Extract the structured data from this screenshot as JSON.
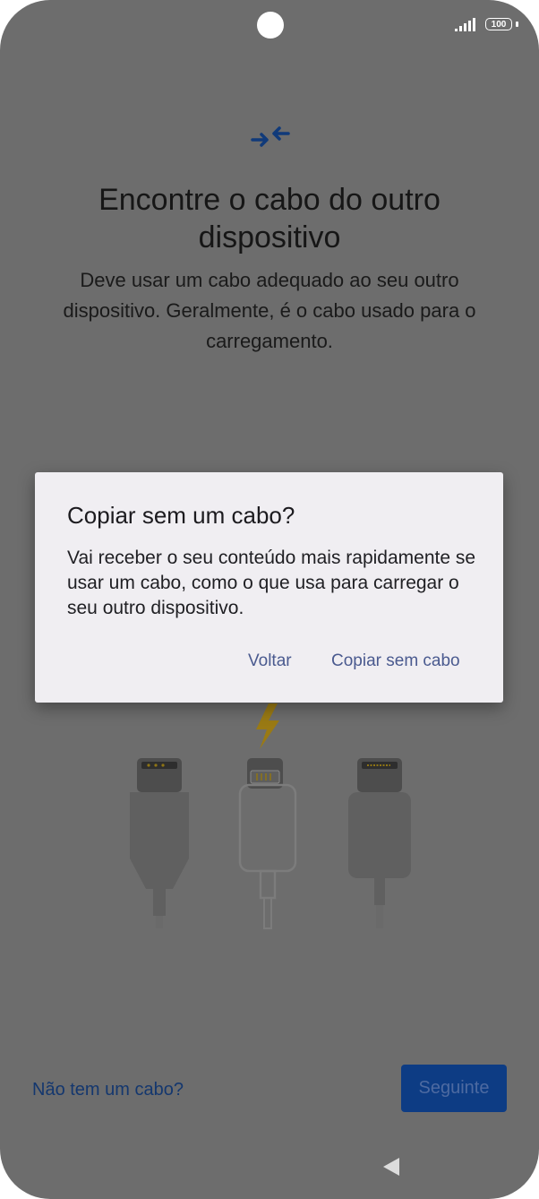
{
  "status_bar": {
    "battery": "100"
  },
  "screen": {
    "title": "Encontre o cabo do outro dispositivo",
    "subtitle": "Deve usar um cabo adequado ao seu outro dispositivo. Geralmente, é o cabo usado para o carregamento.",
    "no_cable_link": "Não tem um cabo?",
    "next_button": "Seguinte"
  },
  "dialog": {
    "title": "Copiar sem um cabo?",
    "message": "Vai receber o seu conteúdo mais rapidamente se usar um cabo, como o que usa para carregar o seu outro dispositivo.",
    "back_button": "Voltar",
    "confirm_button": "Copiar sem cabo"
  },
  "colors": {
    "overlay_background": "#6d6d6d",
    "dialog_background": "#f0eef2",
    "accent": "#0d3c84",
    "dialog_button_text": "#4a5a8f",
    "lightning": "#9a7a14"
  },
  "icons": {
    "top": "transfer-arrows-icon",
    "nav": "back-triangle-icon",
    "illustration": "charging-cables-illustration"
  }
}
